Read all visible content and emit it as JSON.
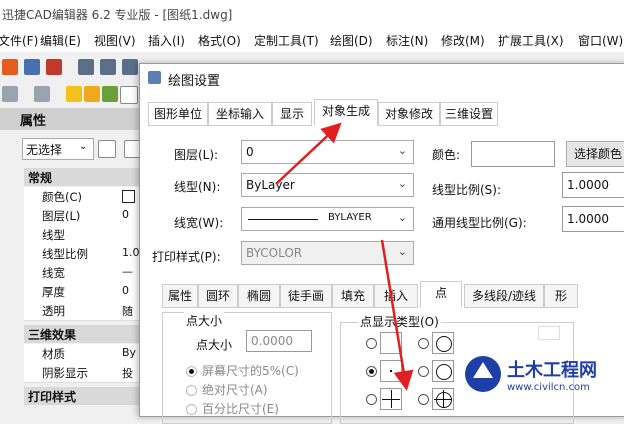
{
  "app": {
    "title": "迅捷CAD编辑器 6.2 专业版 - [图纸1.dwg]"
  },
  "menu": [
    "文件(F)",
    "编辑(E)",
    "视图(V)",
    "插入(I)",
    "格式(O)",
    "定制工具(T)",
    "绘图(D)",
    "标注(N)",
    "修改(M)",
    "扩展工具(X)",
    "窗口(W)"
  ],
  "properties_panel": {
    "title": "属性",
    "selection": "无选择",
    "sections": {
      "general": "常规",
      "three_d": "三维效果",
      "print_style": "打印样式"
    },
    "rows": [
      {
        "k": "颜色(C)",
        "v": ""
      },
      {
        "k": "图层(L)",
        "v": "0"
      },
      {
        "k": "线型",
        "v": ""
      },
      {
        "k": "线型比例",
        "v": "1.0"
      },
      {
        "k": "线宽",
        "v": "—"
      },
      {
        "k": "厚度",
        "v": "0"
      },
      {
        "k": "透明",
        "v": "随"
      }
    ],
    "rows3d": [
      {
        "k": "材质",
        "v": "By"
      },
      {
        "k": "阴影显示",
        "v": "投"
      }
    ]
  },
  "dialog": {
    "title": "绘图设置",
    "tabs": [
      "图形单位",
      "坐标输入",
      "显示",
      "对象生成",
      "对象修改",
      "三维设置"
    ],
    "active_tab": "对象生成",
    "layer_label": "图层(L):",
    "layer_value": "0",
    "color_label": "颜色:",
    "color_button": "选择颜色",
    "linetype_label": "线型(N):",
    "linetype_value": "ByLayer",
    "ltscale_label": "线型比例(S):",
    "ltscale_value": "1.0000",
    "lineweight_label": "线宽(W):",
    "lineweight_value": "BYLAYER",
    "global_ltscale_label": "通用线型比例(G):",
    "global_ltscale_value": "1.0000",
    "plotstyle_label": "打印样式(P):",
    "plotstyle_value": "BYCOLOR",
    "subtabs": [
      "属性",
      "圆环",
      "椭圆",
      "徒手画",
      "填充",
      "插入",
      "点",
      "多线段/迹线",
      "形"
    ],
    "active_subtab": "点",
    "point_size": {
      "group": "点大小",
      "size_label": "点大小",
      "size_value": "0.0000",
      "opt_screen": "屏幕尺寸的5%(C)",
      "opt_absolute": "绝对尺寸(A)",
      "opt_percent": "百分比尺寸(E)"
    },
    "point_type_group": "点显示类型(O)"
  },
  "watermark": {
    "name": "土木工程网",
    "url": "www.civilcn.com"
  },
  "colors": {
    "arrow": "#e02020",
    "accent": "#1f3fa8"
  }
}
